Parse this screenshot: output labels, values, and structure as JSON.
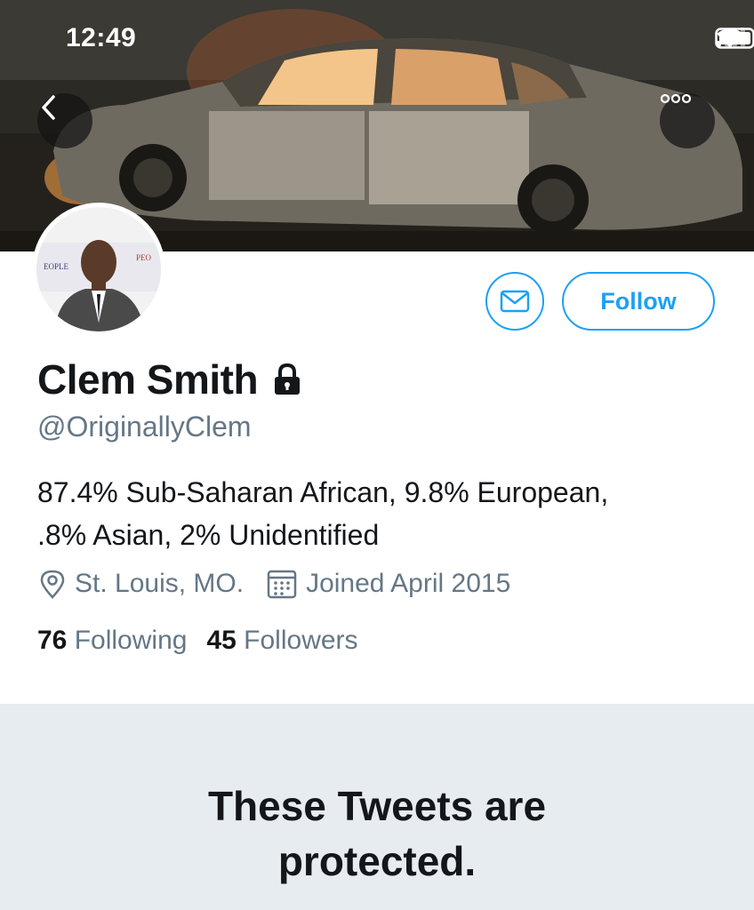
{
  "status_bar": {
    "time": "12:49",
    "icons": [
      "cellular-signal-icon",
      "wifi-icon",
      "battery-icon"
    ]
  },
  "header": {
    "back_icon": "chevron-left-icon",
    "more_icon": "more-dots-icon",
    "banner_description_icon": "banner-image"
  },
  "actions": {
    "message_icon": "envelope-icon",
    "follow_label": "Follow"
  },
  "profile": {
    "name": "Clem Smith",
    "protected_icon": "lock-icon",
    "handle": "@OriginallyClem",
    "bio_line1": "87.4% Sub-Saharan African, 9.8% European,",
    "bio_line2": ".8% Asian, 2% Unidentified",
    "location": "St. Louis, MO.",
    "joined": "Joined April 2015",
    "following_count": "76",
    "following_label": "Following",
    "followers_count": "45",
    "followers_label": "Followers"
  },
  "protected_notice": {
    "line1": "These Tweets are",
    "line2": "protected."
  },
  "colors": {
    "accent": "#1da1f2",
    "secondary_text": "#657786",
    "primary_text": "#14171a",
    "notice_bg": "#e6ecf0"
  }
}
